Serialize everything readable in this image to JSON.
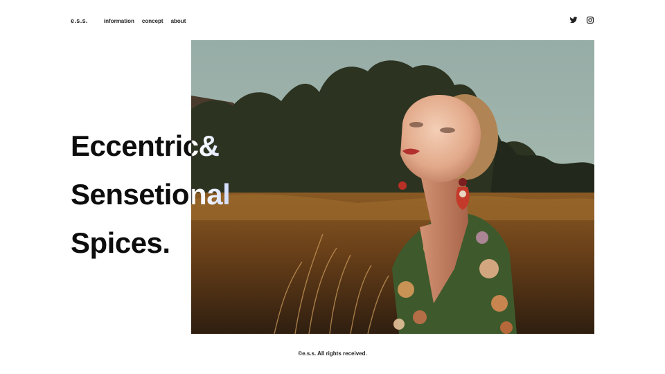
{
  "header": {
    "logo": "e.s.s.",
    "nav": [
      "information",
      "concept",
      "about"
    ],
    "social_icons": [
      "twitter-icon",
      "instagram-icon"
    ]
  },
  "hero": {
    "headline": [
      "Eccentric&",
      "Sensetional",
      "Spices."
    ],
    "image": "photo-woman-in-field"
  },
  "footer": {
    "copyright": "©e.s.s. All rights received."
  },
  "colors": {
    "text": "#0d0d0d",
    "background": "#ffffff",
    "headline_overlay_tint": "#c9d6ff"
  }
}
